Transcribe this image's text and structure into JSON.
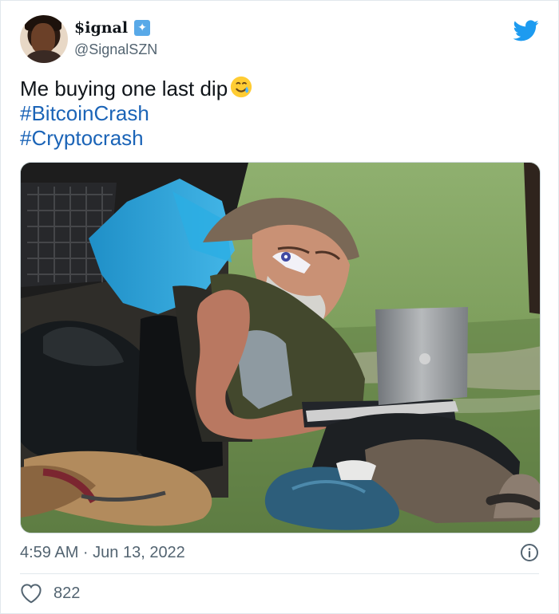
{
  "author": {
    "display_name": "$ignal",
    "badge_icon": "star-rocket-icon",
    "handle": "@SignalSZN"
  },
  "tweet": {
    "text": "Me buying one last dip",
    "emoji": "smiling-face-with-tear-icon",
    "hashtags": [
      "#BitcoinCrash",
      "#Cryptocrash"
    ],
    "image_alt": "Man with a long gray beard sitting outdoors among bags using a laptop next to a sleeping dog"
  },
  "meta": {
    "timestamp": "4:59 AM · Jun 13, 2022",
    "likes": "822"
  },
  "colors": {
    "twitter_blue": "#1d9bf0",
    "hashtag_blue": "#1b64b7",
    "muted_text": "#536471",
    "divider": "#e1e8ed"
  }
}
